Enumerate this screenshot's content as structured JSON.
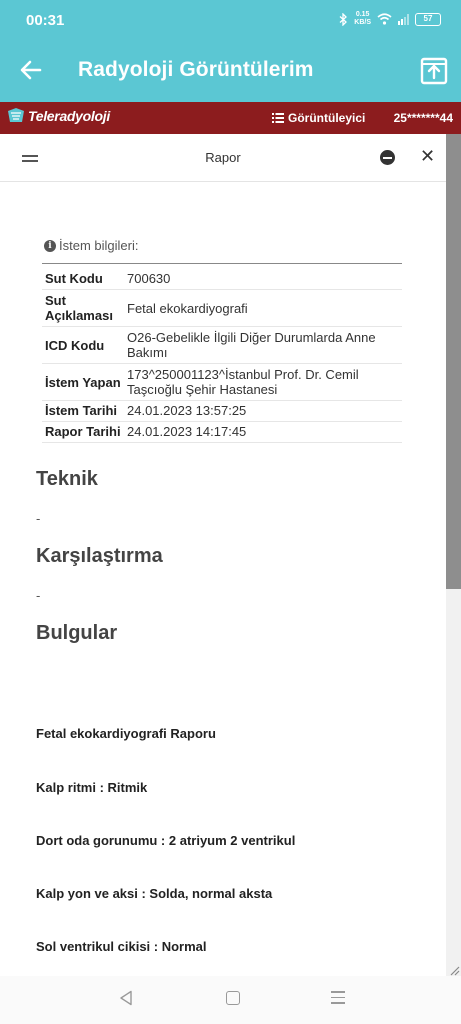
{
  "status": {
    "time": "00:31",
    "speed_value": "0.15",
    "speed_unit": "KB/S",
    "battery": "57"
  },
  "appbar": {
    "title": "Radyoloji Görüntülerim"
  },
  "brand": {
    "logo_text": "Teleradyoloji",
    "viewer_label": "Görüntüleyici",
    "patient_id": "25*******44"
  },
  "panel": {
    "title": "Rapor"
  },
  "info": {
    "heading": "İstem bilgileri:",
    "rows": [
      {
        "key": "Sut Kodu",
        "value": "700630"
      },
      {
        "key": "Sut Açıklaması",
        "value": "Fetal ekokardiyografi"
      },
      {
        "key": "ICD Kodu",
        "value": "O26-Gebelikle İlgili Diğer Durumlarda Anne Bakımı"
      },
      {
        "key": "İstem Yapan",
        "value": "173^250001123^İstanbul Prof. Dr. Cemil Taşcıoğlu Şehir Hastanesi"
      },
      {
        "key": "İstem Tarihi",
        "value": "24.01.2023 13:57:25"
      },
      {
        "key": "Rapor Tarihi",
        "value": "24.01.2023 14:17:45"
      }
    ]
  },
  "sections": {
    "teknik": {
      "title": "Teknik",
      "text": "-"
    },
    "karsilastirma": {
      "title": "Karşılaştırma",
      "text": "-"
    },
    "bulgular": {
      "title": "Bulgular"
    }
  },
  "findings": [
    "Fetal ekokardiyografi Raporu",
    "Kalp ritmi : Ritmik",
    "Dort oda gorunumu : 2 atriyum 2 ventrikul",
    "Kalp yon ve aksi : Solda, normal aksta",
    "Sol ventrikul cikisi : Normal"
  ],
  "colors": {
    "appbar": "#5bc7d3",
    "brandbar": "#8c1c1e"
  }
}
